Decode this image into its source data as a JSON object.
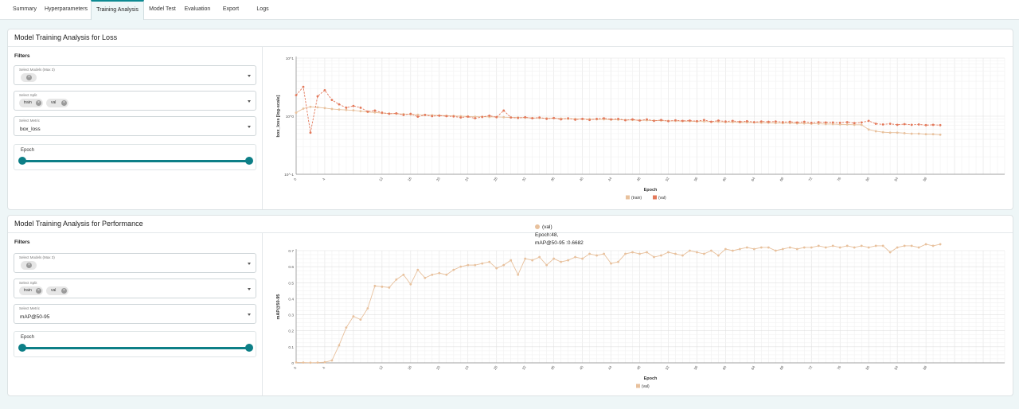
{
  "tabs": [
    {
      "label": "Summary",
      "active": false
    },
    {
      "label": "Hyperparameters",
      "active": false
    },
    {
      "label": "Training Analysis",
      "active": true
    },
    {
      "label": "Model Test",
      "active": false
    },
    {
      "label": "Evaluation",
      "active": false
    },
    {
      "label": "Export",
      "active": false
    },
    {
      "label": "Logs",
      "active": false
    }
  ],
  "loss_panel": {
    "title": "Model Training Analysis for Loss",
    "filters_label": "Filters",
    "models_label": "Select Models (Max 3)",
    "split_label": "Select Split",
    "split_chips": [
      "train",
      "val"
    ],
    "metric_label": "Select Metric",
    "metric_value": "box_loss",
    "epoch_label": "Epoch",
    "epoch_range": [
      0,
      1
    ]
  },
  "perf_panel": {
    "title": "Model Training Analysis for Performance",
    "filters_label": "Filters",
    "models_label": "Select Models (Max 3)",
    "split_label": "Select Split",
    "split_chips": [
      "train",
      "val"
    ],
    "metric_label": "Select Metric",
    "metric_value": "mAP@50-95",
    "epoch_label": "Epoch",
    "epoch_range": [
      0,
      1
    ]
  },
  "tooltip": {
    "series": "(val)",
    "epoch_line": "Epoch:48,",
    "value_line": "mAP@50-95 :0.6682"
  },
  "chart_data": [
    {
      "type": "line",
      "xlabel": "Epoch",
      "ylabel": "box_loss [log-scale]",
      "yscale": "log",
      "yticks": [
        "10^1",
        "10^0",
        "10^-1"
      ],
      "xlim": [
        0,
        99
      ],
      "xticks": [
        0,
        4,
        12,
        16,
        20,
        24,
        28,
        32,
        36,
        40,
        44,
        48,
        52,
        56,
        60,
        64,
        68,
        72,
        76,
        80,
        84,
        88
      ],
      "grid": true,
      "legend_position": "bottom",
      "colors": {
        "train": "#e8c19d",
        "val": "#e3795b"
      },
      "series": [
        {
          "name": "(train)",
          "style": "solid",
          "values": [
            1.15,
            1.35,
            1.45,
            1.42,
            1.38,
            1.33,
            1.3,
            1.28,
            1.26,
            1.22,
            1.18,
            1.16,
            1.13,
            1.11,
            1.1,
            1.09,
            1.07,
            1.06,
            1.05,
            1.04,
            1.03,
            1.02,
            1.01,
            1.0,
            0.99,
            0.98,
            0.98,
            0.97,
            0.97,
            0.96,
            0.95,
            0.95,
            0.94,
            0.93,
            0.93,
            0.92,
            0.92,
            0.91,
            0.9,
            0.9,
            0.89,
            0.89,
            0.88,
            0.88,
            0.87,
            0.87,
            0.86,
            0.86,
            0.85,
            0.85,
            0.84,
            0.84,
            0.83,
            0.83,
            0.82,
            0.82,
            0.81,
            0.81,
            0.8,
            0.8,
            0.79,
            0.79,
            0.78,
            0.78,
            0.78,
            0.77,
            0.77,
            0.76,
            0.76,
            0.76,
            0.75,
            0.75,
            0.74,
            0.74,
            0.73,
            0.73,
            0.72,
            0.72,
            0.71,
            0.71,
            0.59,
            0.55,
            0.53,
            0.52,
            0.52,
            0.51,
            0.5,
            0.5,
            0.49,
            0.49,
            0.48
          ]
        },
        {
          "name": "(val)",
          "style": "dashed",
          "values": [
            2.3,
            3.2,
            0.52,
            2.2,
            2.8,
            1.9,
            1.6,
            1.4,
            1.5,
            1.4,
            1.2,
            1.25,
            1.15,
            1.1,
            1.12,
            1.05,
            1.1,
            0.98,
            1.05,
            1.0,
            1.02,
            1.0,
            0.99,
            0.95,
            0.98,
            0.92,
            0.97,
            1.02,
            0.96,
            1.25,
            0.95,
            0.93,
            0.96,
            0.92,
            0.95,
            0.9,
            0.93,
            0.88,
            0.92,
            0.87,
            0.9,
            0.86,
            0.9,
            0.92,
            0.88,
            0.9,
            0.85,
            0.88,
            0.84,
            0.88,
            0.83,
            0.86,
            0.82,
            0.85,
            0.83,
            0.84,
            0.82,
            0.86,
            0.8,
            0.84,
            0.81,
            0.83,
            0.8,
            0.82,
            0.79,
            0.81,
            0.8,
            0.81,
            0.79,
            0.8,
            0.78,
            0.8,
            0.77,
            0.79,
            0.78,
            0.78,
            0.77,
            0.79,
            0.76,
            0.78,
            0.83,
            0.74,
            0.72,
            0.74,
            0.71,
            0.73,
            0.71,
            0.72,
            0.7,
            0.71,
            0.7
          ]
        }
      ]
    },
    {
      "type": "line",
      "xlabel": "Epoch",
      "ylabel": "mAP@50-95",
      "ylim": [
        0,
        0.7
      ],
      "yticks": [
        0,
        0.1,
        0.2,
        0.3,
        0.4,
        0.5,
        0.6,
        0.7
      ],
      "xlim": [
        0,
        99
      ],
      "xticks": [
        0,
        4,
        12,
        16,
        20,
        24,
        28,
        32,
        36,
        40,
        44,
        48,
        52,
        56,
        60,
        64,
        68,
        72,
        76,
        80,
        84,
        88
      ],
      "grid": true,
      "legend_position": "bottom",
      "colors": {
        "val": "#e8c19d"
      },
      "series": [
        {
          "name": "(val)",
          "style": "solid",
          "values": [
            0.003,
            0.002,
            0.001,
            0.002,
            0.004,
            0.015,
            0.11,
            0.22,
            0.29,
            0.27,
            0.34,
            0.48,
            0.475,
            0.47,
            0.52,
            0.55,
            0.49,
            0.58,
            0.53,
            0.55,
            0.56,
            0.55,
            0.58,
            0.6,
            0.61,
            0.61,
            0.62,
            0.63,
            0.59,
            0.61,
            0.64,
            0.55,
            0.65,
            0.64,
            0.66,
            0.61,
            0.65,
            0.63,
            0.64,
            0.66,
            0.65,
            0.68,
            0.67,
            0.68,
            0.62,
            0.63,
            0.68,
            0.69,
            0.68,
            0.69,
            0.66,
            0.67,
            0.69,
            0.68,
            0.67,
            0.7,
            0.69,
            0.68,
            0.7,
            0.67,
            0.71,
            0.7,
            0.71,
            0.72,
            0.71,
            0.72,
            0.72,
            0.7,
            0.71,
            0.72,
            0.71,
            0.72,
            0.72,
            0.73,
            0.72,
            0.73,
            0.72,
            0.73,
            0.72,
            0.73,
            0.72,
            0.73,
            0.73,
            0.69,
            0.72,
            0.73,
            0.73,
            0.72,
            0.74,
            0.73,
            0.74
          ]
        }
      ]
    }
  ]
}
